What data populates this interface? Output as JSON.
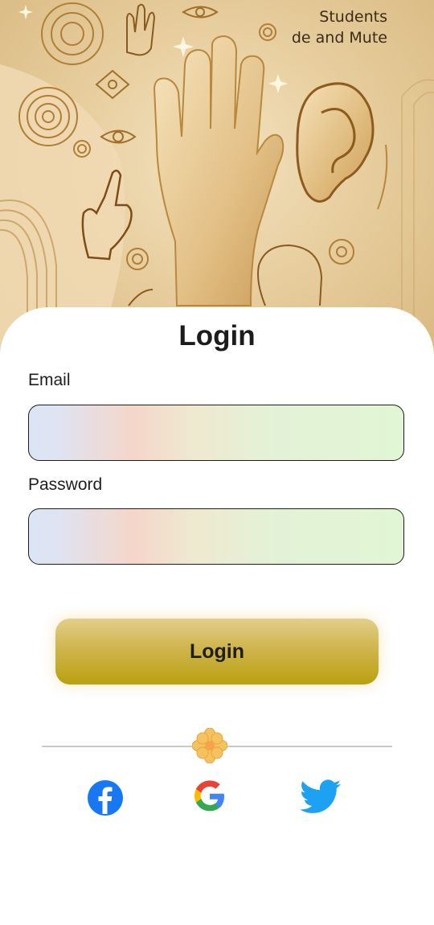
{
  "hero": {
    "caption_line1": "Students",
    "caption_line2": "de and Mute"
  },
  "form": {
    "title": "Login",
    "email_label": "Email",
    "email_value": "",
    "password_label": "Password",
    "password_value": "",
    "login_button": "Login"
  },
  "social": {
    "icons": [
      "facebook-icon",
      "google-icon",
      "twitter-icon"
    ],
    "facebook_color": "#1877F2",
    "twitter_color": "#1DA1F2"
  },
  "colors": {
    "button_gold": "#c9b030",
    "hero_bg": "#e8cfa0"
  }
}
